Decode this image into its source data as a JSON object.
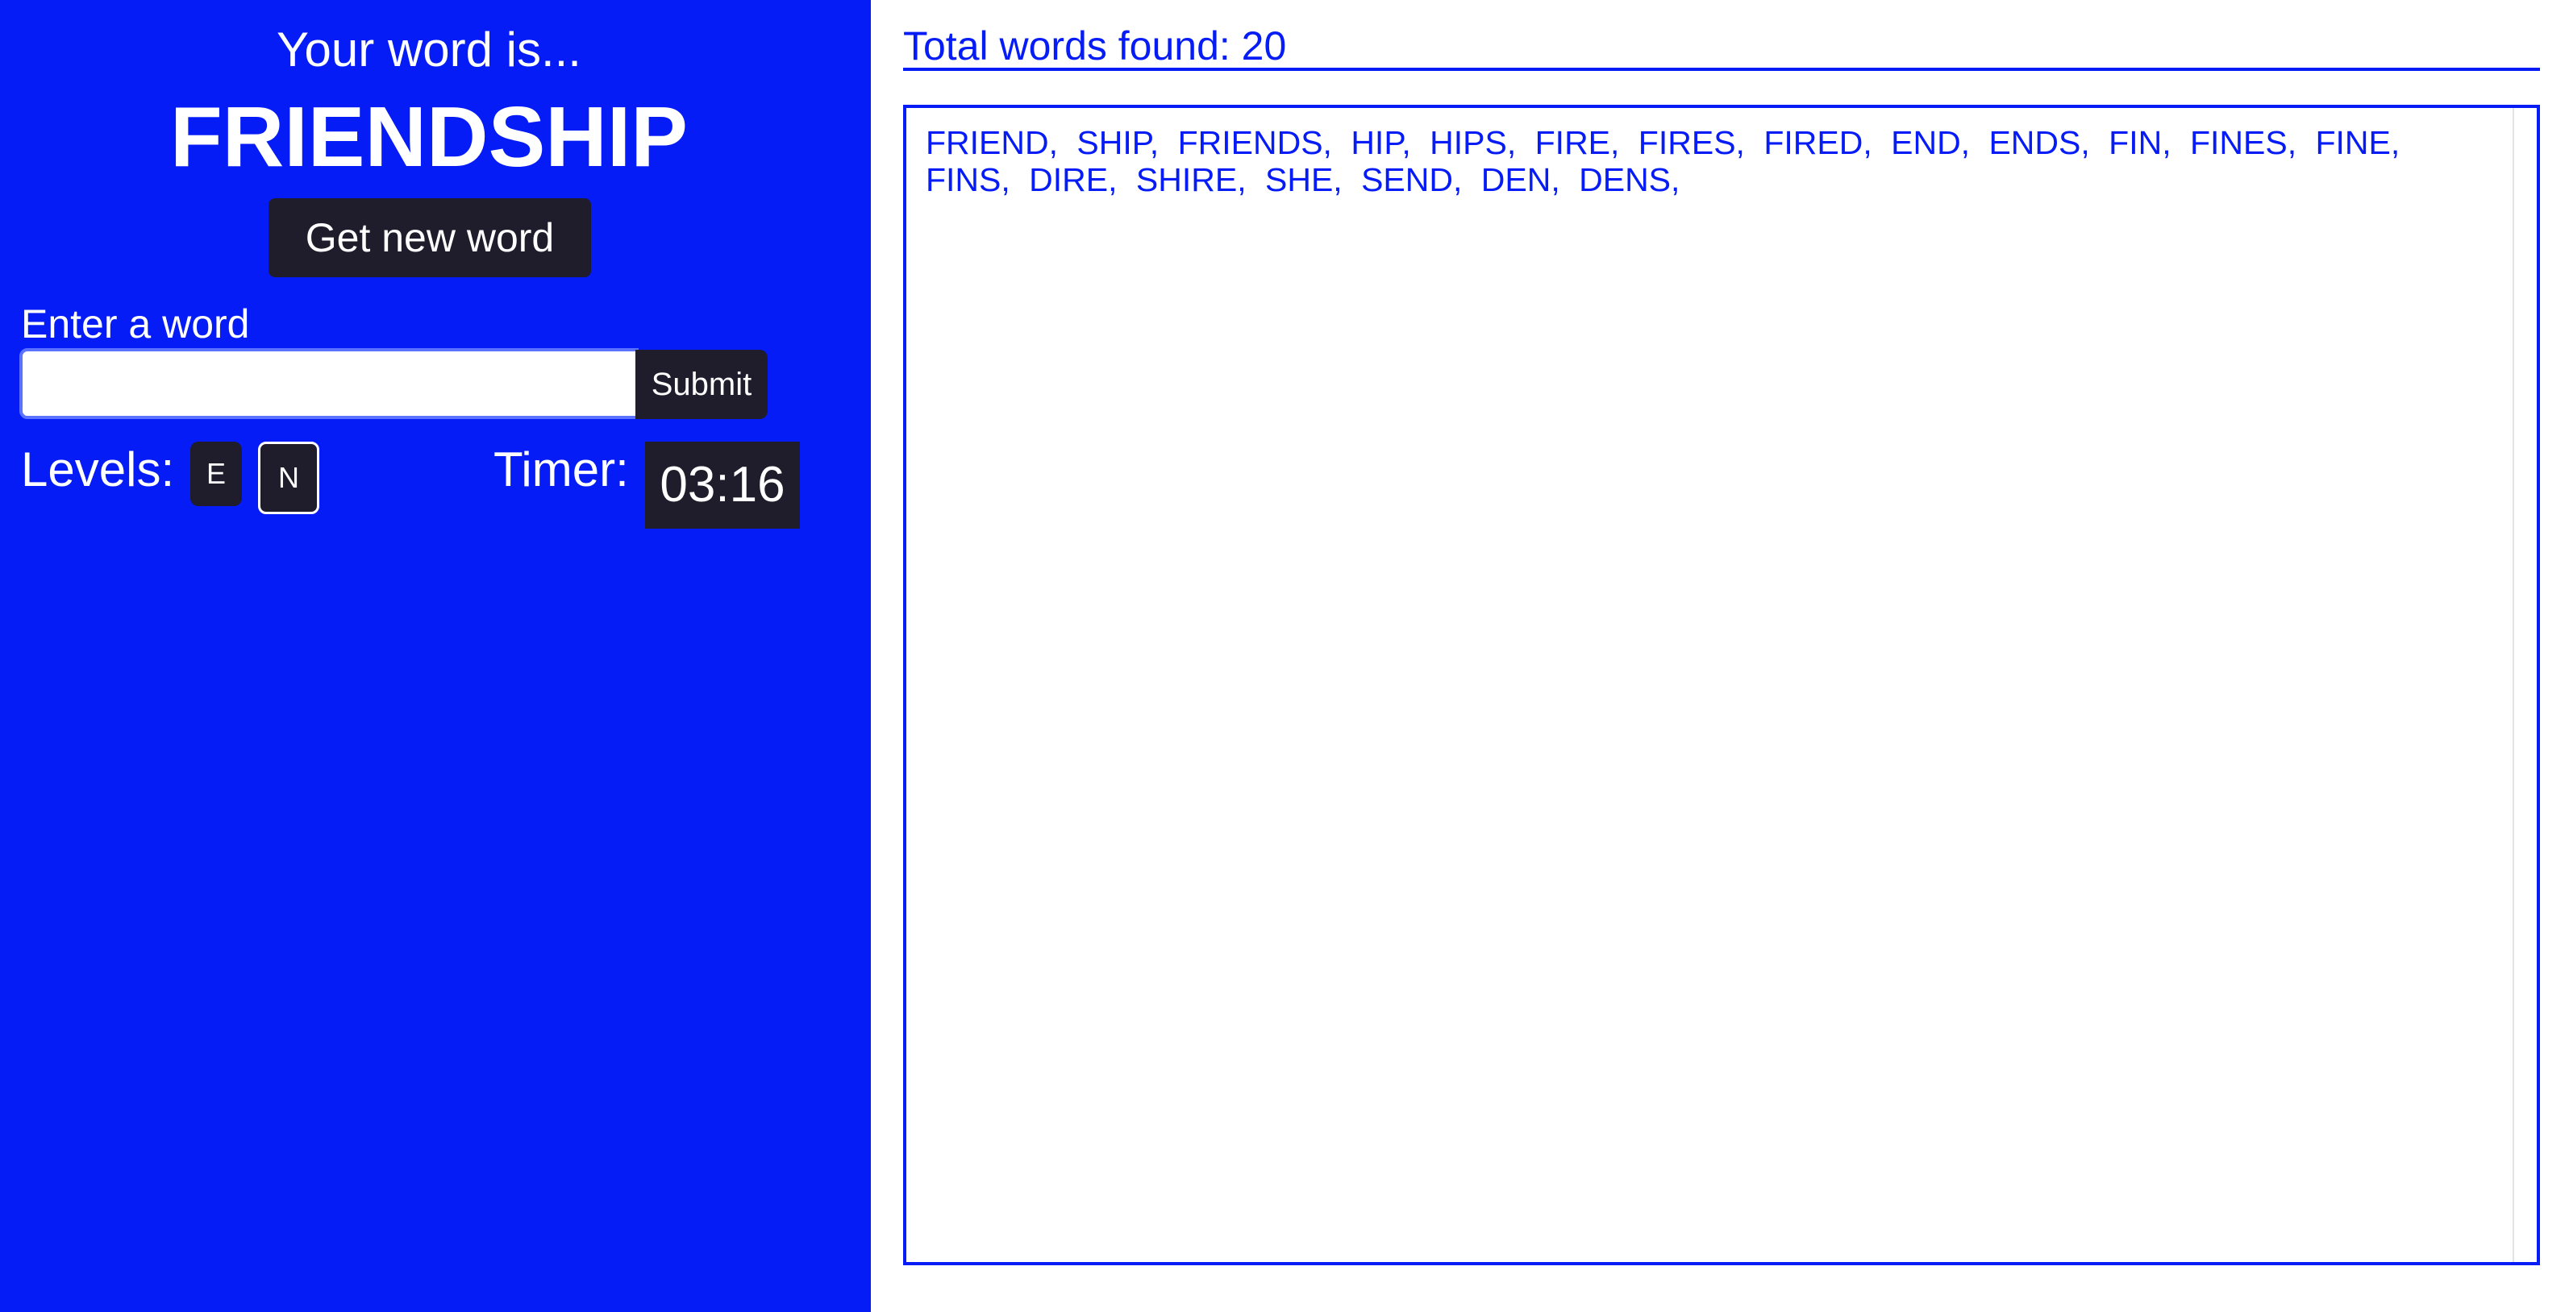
{
  "left_panel": {
    "intro": "Your word is...",
    "word": "FRIENDSHIP",
    "new_word_label": "Get new word",
    "enter_label": "Enter a word",
    "input_value": "",
    "input_placeholder": "",
    "submit_label": "Submit",
    "levels_label": "Levels:",
    "levels": [
      "E",
      "N"
    ],
    "timer_label": "Timer:",
    "timer_value": "03:16"
  },
  "right_panel": {
    "total_found": "Total words found: 20",
    "words_text": "FRIEND, SHIP, FRIENDS, HIP, HIPS, FIRE, FIRES, FIRED, END, ENDS, FIN, FINES, FINE, FINS, DIRE, SHIRE, SHE, SEND, DEN, DENS,"
  },
  "colors": {
    "brand_blue": "#051cf6",
    "button_dark": "#1f1d2b",
    "white": "#ffffff"
  }
}
